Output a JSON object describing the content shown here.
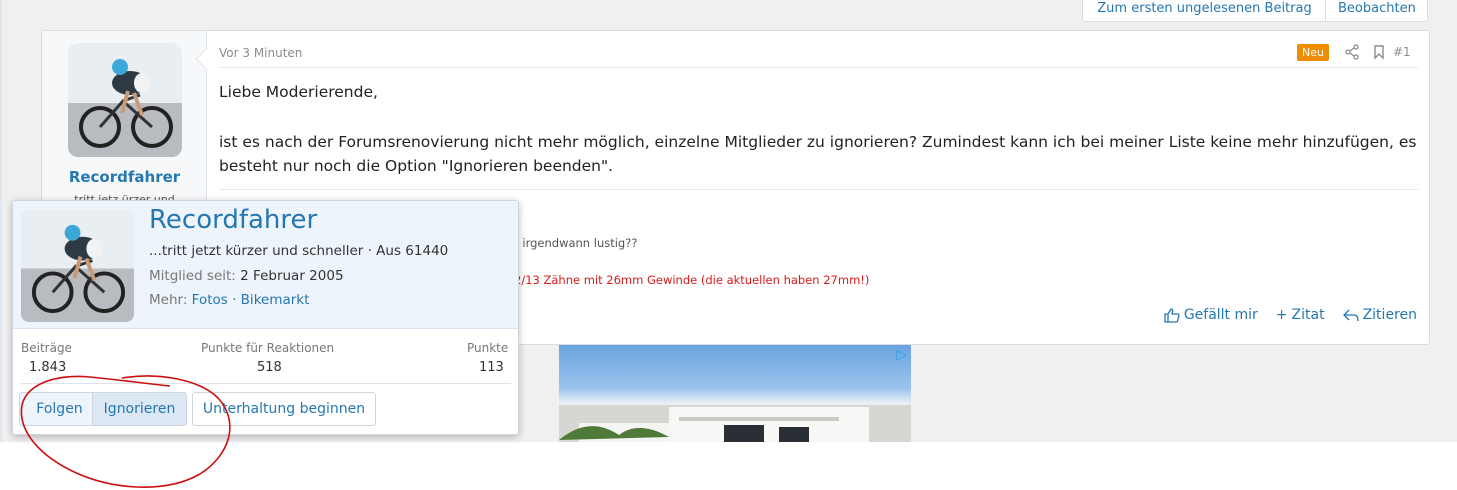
{
  "topbar": {
    "first_unread": "Zum ersten ungelesenen Beitrag",
    "watch": "Beobachten"
  },
  "post": {
    "time": "Vor 3 Minuten",
    "badge": "Neu",
    "number": "#1",
    "greeting": "Liebe Moderierende,",
    "body": "ist es nach der Forumsrenovierung nicht mehr möglich, einzelne Mitglieder zu ignorieren? Zumindest kann ich bei meiner Liste keine mehr hinzufügen, es besteht nur noch die Option \"Ignorieren beenden\".",
    "signature_line1": "r irgendwann lustig??",
    "signature_line2": "2/13 Zähne mit 26mm Gewinde (die aktuellen haben 27mm!)",
    "actions": {
      "like": "Gefällt mir",
      "quote_add": "Zitat",
      "reply": "Zitieren"
    }
  },
  "author": {
    "name": "Recordfahrer",
    "title_short": "tritt jetz   ürzer und"
  },
  "card": {
    "name": "Recordfahrer",
    "title": "...tritt jetzt kürzer und schneller · Aus 61440",
    "member_label": "Mitglied seit:",
    "member_since": "2 Februar 2005",
    "more_label": "Mehr:",
    "more_links": "Fotos · Bikemarkt",
    "stats": [
      {
        "label": "Beiträge",
        "value": "1.843"
      },
      {
        "label": "Punkte für Reaktionen",
        "value": "518"
      },
      {
        "label": "Punkte",
        "value": "113"
      }
    ],
    "buttons": {
      "follow": "Folgen",
      "ignore": "Ignorieren",
      "conversation": "Unterhaltung beginnen"
    }
  },
  "colors": {
    "link": "#2577b1",
    "badge_new": "#f08c00",
    "annotation": "#cc1111"
  }
}
